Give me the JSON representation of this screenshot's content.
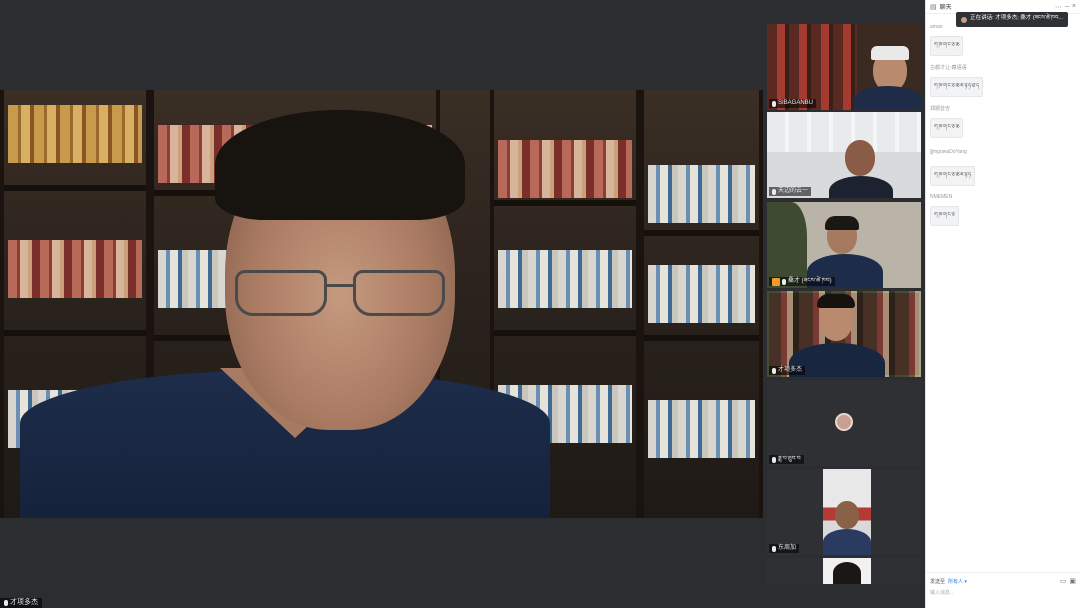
{
  "main": {
    "speaker_name": "才项多杰"
  },
  "gallery": [
    {
      "name": "SIBAGANBU",
      "active": false,
      "camera": true
    },
    {
      "name": "天边的云一",
      "active": false,
      "camera": true
    },
    {
      "name": "桑才 (ཟངས་ཚེ་ཁབ)",
      "active": false,
      "camera": true
    },
    {
      "name": "才项多杰",
      "active": true,
      "camera": true
    },
    {
      "name": "ཟླ་བ་ཐུབ་བ",
      "active": false,
      "camera": false
    },
    {
      "name": "东周加",
      "active": false,
      "camera": true
    },
    {
      "name": "",
      "active": false,
      "camera": true
    }
  ],
  "chat": {
    "title": "聊天",
    "speaking_label": "正在讲话: 才项多杰; 桑才 (ཟངས་ཚེ་ཁབ...",
    "messages": [
      {
        "sender": "aman",
        "text": "ཀ་ཁ་ག་ང་ཅ་ཆ"
      },
      {
        "sender": "古都才让-藏语语",
        "text": "ཀ་ཁ་ག་ང་ཅ་ཆ་ཇ་ཉ་ཏ་ཐ་ད"
      },
      {
        "sender": "郑顺曾吉",
        "text": "ཀ་ཁ་ག་ང་ཅ་ཆ"
      },
      {
        "sender": "ཟླmgowaDoYang",
        "text": "ཀ་ཁ་ག་ང་ཅ་ཆ་ཇ་ཉ་ཏ"
      },
      {
        "sender": "NMEMEN",
        "text": "ཀ་ཁ་ག་ང་ཅ"
      }
    ],
    "send_to_label": "发送至",
    "send_to_value": "所有人 ▾",
    "input_placeholder": "输入消息..."
  }
}
